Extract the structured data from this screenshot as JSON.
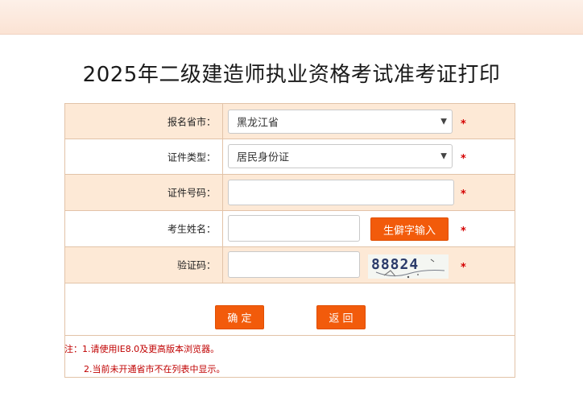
{
  "page": {
    "title": "2025年二级建造师执业资格考试准考证打印"
  },
  "form": {
    "province": {
      "label": "报名省市：",
      "value": "黑龙江省",
      "required_mark": "*"
    },
    "id_type": {
      "label": "证件类型：",
      "value": "居民身份证",
      "required_mark": "*"
    },
    "id_number": {
      "label": "证件号码：",
      "value": "",
      "required_mark": "*"
    },
    "name": {
      "label": "考生姓名：",
      "value": "",
      "rare_char_button": "生僻字输入",
      "required_mark": "*"
    },
    "captcha": {
      "label": "验证码：",
      "value": "",
      "image_text": "88824",
      "required_mark": "*"
    },
    "buttons": {
      "confirm": "确 定",
      "back": "返 回"
    }
  },
  "notes": {
    "line1": "注：1.请使用IE8.0及更高版本浏览器。",
    "line2": "2.当前未开通省市不在列表中显示。"
  },
  "colors": {
    "accent_button": "#f25b0b",
    "row_highlight": "#fde9d6",
    "required_mark": "#d40000",
    "note_text": "#c00000"
  }
}
